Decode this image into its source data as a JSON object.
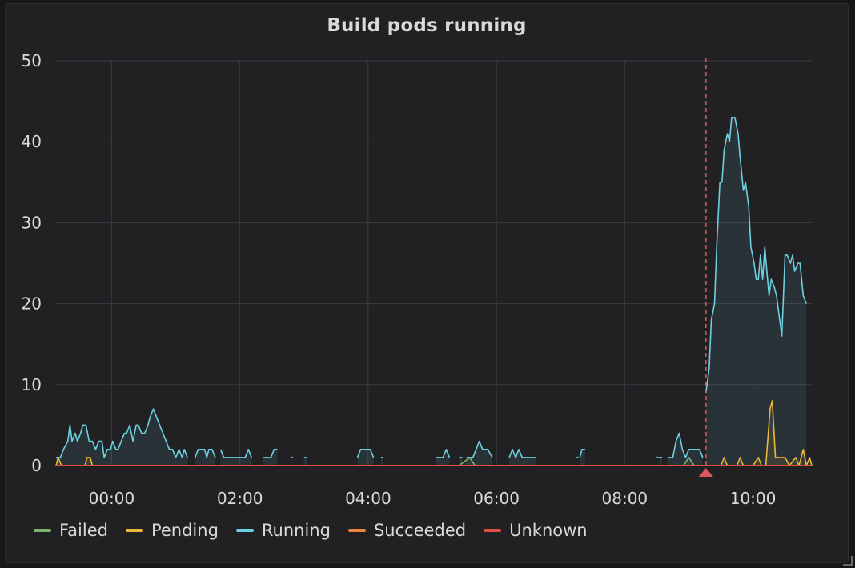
{
  "panel": {
    "title": "Build pods running"
  },
  "chart_data": {
    "type": "line",
    "title": "Build pods running",
    "xlabel": "",
    "ylabel": "",
    "x_tick_labels": [
      "00:00",
      "02:00",
      "04:00",
      "06:00",
      "08:00",
      "10:00"
    ],
    "x_range": [
      "23:08",
      "10:55"
    ],
    "y_ticks": [
      0,
      10,
      20,
      30,
      40,
      50
    ],
    "ylim": [
      0,
      50
    ],
    "grid": true,
    "legend_position": "bottom",
    "annotation": {
      "time": "09:16",
      "color": "#e0575b",
      "style": "dashed"
    },
    "series": [
      {
        "name": "Failed",
        "color": "#7eb26d",
        "points": [
          [
            "23:08",
            0
          ],
          [
            "05:25",
            0
          ],
          [
            "05:35",
            1
          ],
          [
            "05:40",
            0
          ],
          [
            "08:55",
            0
          ],
          [
            "09:00",
            1
          ],
          [
            "09:05",
            0
          ],
          [
            "10:55",
            0
          ]
        ]
      },
      {
        "name": "Pending",
        "color": "#eab839",
        "points": [
          [
            "23:08",
            0
          ],
          [
            "23:10",
            1
          ],
          [
            "23:13",
            0
          ],
          [
            "23:35",
            0
          ],
          [
            "23:37",
            1
          ],
          [
            "23:40",
            1
          ],
          [
            "23:42",
            0
          ],
          [
            "09:30",
            0
          ],
          [
            "09:33",
            1
          ],
          [
            "09:36",
            0
          ],
          [
            "09:45",
            0
          ],
          [
            "09:48",
            1
          ],
          [
            "09:51",
            0
          ],
          [
            "10:00",
            0
          ],
          [
            "10:05",
            1
          ],
          [
            "10:08",
            0
          ],
          [
            "10:12",
            0
          ],
          [
            "10:16",
            7
          ],
          [
            "10:18",
            8
          ],
          [
            "10:21",
            1
          ],
          [
            "10:30",
            1
          ],
          [
            "10:34",
            0
          ],
          [
            "10:40",
            1
          ],
          [
            "10:43",
            0
          ],
          [
            "10:47",
            2
          ],
          [
            "10:50",
            0
          ],
          [
            "10:53",
            1
          ],
          [
            "10:55",
            0
          ]
        ]
      },
      {
        "name": "Running",
        "color": "#6ed0e0",
        "gaps": [
          [
            "23:08",
            1
          ],
          [
            "23:15",
            2
          ],
          [
            "23:20",
            3
          ],
          [
            "23:22",
            5
          ],
          [
            "23:25",
            3
          ],
          [
            "23:28",
            4
          ],
          [
            "23:31",
            3
          ],
          [
            "23:34",
            5
          ],
          [
            "23:37",
            5
          ],
          [
            "23:40",
            3
          ],
          [
            "23:43",
            2
          ],
          [
            "23:46",
            3
          ],
          [
            "23:49",
            3
          ],
          [
            "23:52",
            1
          ],
          [
            "23:55",
            2
          ],
          [
            "23:58",
            2
          ],
          [
            "00:01",
            3
          ],
          [
            "00:04",
            2
          ],
          [
            "00:07",
            2
          ],
          [
            "00:10",
            3
          ],
          [
            "00:13",
            4
          ],
          [
            "00:16",
            4
          ],
          [
            "00:19",
            5
          ],
          [
            "00:22",
            4
          ],
          [
            "00:25",
            5
          ],
          [
            "00:28",
            5
          ],
          [
            "00:31",
            4
          ],
          [
            "00:34",
            4
          ],
          [
            "00:37",
            5
          ],
          [
            "00:40",
            6
          ],
          [
            "00:43",
            7
          ],
          [
            "00:46",
            6
          ],
          [
            "00:49",
            5
          ],
          [
            "00:52",
            4
          ],
          [
            "00:55",
            3
          ],
          [
            "00:58",
            2
          ],
          [
            "01:01",
            2
          ],
          [
            "01:04",
            1
          ],
          [
            "01:07",
            1
          ],
          [
            "01:10",
            2
          ],
          [
            "01:13",
            2
          ],
          [
            "01:16",
            1
          ],
          [
            "01:19",
            1
          ],
          [
            "01:22",
            2
          ],
          [
            "01:25",
            1
          ],
          [
            "01:28",
            1
          ]
        ],
        "segments": [
          [
            [
              "23:08",
              1
            ],
            [
              "23:12",
              1
            ],
            [
              "23:15",
              2
            ],
            [
              "23:19",
              3
            ],
            [
              "23:21",
              5
            ],
            [
              "23:23",
              3
            ],
            [
              "23:26",
              4
            ],
            [
              "23:28",
              3
            ],
            [
              "23:31",
              4
            ],
            [
              "23:33",
              5
            ],
            [
              "23:36",
              5
            ],
            [
              "23:39",
              3
            ],
            [
              "23:42",
              3
            ],
            [
              "23:45",
              2
            ],
            [
              "23:48",
              3
            ],
            [
              "23:51",
              3
            ],
            [
              "23:53",
              1
            ],
            [
              "23:56",
              2
            ],
            [
              "23:59",
              2
            ],
            [
              "00:01",
              3
            ],
            [
              "00:04",
              2
            ],
            [
              "00:06",
              2
            ],
            [
              "00:09",
              3
            ],
            [
              "00:12",
              4
            ],
            [
              "00:14",
              4
            ],
            [
              "00:17",
              5
            ],
            [
              "00:20",
              3
            ],
            [
              "00:23",
              5
            ],
            [
              "00:25",
              5
            ],
            [
              "00:28",
              4
            ],
            [
              "00:31",
              4
            ],
            [
              "00:34",
              5
            ],
            [
              "00:36",
              6
            ],
            [
              "00:39",
              7
            ],
            [
              "00:42",
              6
            ],
            [
              "00:45",
              5
            ],
            [
              "00:48",
              4
            ],
            [
              "00:51",
              3
            ],
            [
              "00:54",
              2
            ],
            [
              "00:57",
              2
            ],
            [
              "01:00",
              1
            ],
            [
              "01:03",
              2
            ],
            [
              "01:06",
              1
            ],
            [
              "01:08",
              2
            ],
            [
              "01:11",
              1
            ]
          ],
          [
            [
              "01:18",
              1
            ],
            [
              "01:21",
              2
            ],
            [
              "01:27",
              2
            ],
            [
              "01:29",
              1
            ],
            [
              "01:31",
              2
            ],
            [
              "01:34",
              2
            ],
            [
              "01:37",
              1
            ]
          ],
          [
            [
              "01:42",
              2
            ],
            [
              "01:45",
              1
            ],
            [
              "02:05",
              1
            ],
            [
              "02:08",
              2
            ],
            [
              "02:11",
              1
            ]
          ],
          [
            [
              "02:22",
              1
            ],
            [
              "02:29",
              1
            ],
            [
              "02:32",
              2
            ],
            [
              "02:35",
              2
            ]
          ],
          [
            [
              "02:48",
              1
            ]
          ],
          [
            [
              "03:00",
              1
            ],
            [
              "03:03",
              1
            ]
          ],
          [
            [
              "03:50",
              1
            ],
            [
              "03:53",
              2
            ],
            [
              "04:02",
              2
            ],
            [
              "04:05",
              1
            ]
          ],
          [
            [
              "04:12",
              1
            ],
            [
              "04:14",
              1
            ]
          ],
          [
            [
              "05:03",
              1
            ],
            [
              "05:10",
              1
            ],
            [
              "05:13",
              2
            ],
            [
              "05:16",
              1
            ]
          ],
          [
            [
              "05:25",
              1
            ],
            [
              "05:28",
              1
            ]
          ],
          [
            [
              "05:32",
              1
            ],
            [
              "05:38",
              1
            ],
            [
              "05:41",
              2
            ],
            [
              "05:44",
              3
            ],
            [
              "05:47",
              2
            ],
            [
              "05:52",
              2
            ],
            [
              "05:56",
              1
            ]
          ],
          [
            [
              "06:12",
              1
            ],
            [
              "06:15",
              2
            ],
            [
              "06:18",
              1
            ],
            [
              "06:21",
              2
            ],
            [
              "06:24",
              1
            ],
            [
              "06:33",
              1
            ],
            [
              "06:37",
              1
            ]
          ],
          [
            [
              "07:15",
              1
            ]
          ],
          [
            [
              "07:18",
              1
            ],
            [
              "07:20",
              2
            ],
            [
              "07:23",
              2
            ]
          ],
          [
            [
              "08:30",
              1
            ]
          ],
          [
            [
              "08:32",
              1
            ],
            [
              "08:35",
              1
            ]
          ],
          [
            [
              "08:40",
              1
            ],
            [
              "08:45",
              1
            ],
            [
              "08:48",
              3
            ],
            [
              "08:51",
              4
            ],
            [
              "08:54",
              2
            ],
            [
              "08:57",
              1
            ],
            [
              "09:00",
              2
            ],
            [
              "09:10",
              2
            ],
            [
              "09:13",
              1
            ]
          ],
          [
            [
              "09:16",
              9
            ],
            [
              "09:19",
              12
            ],
            [
              "09:21",
              18
            ],
            [
              "09:24",
              20
            ],
            [
              "09:26",
              27
            ],
            [
              "09:29",
              35
            ],
            [
              "09:31",
              35
            ],
            [
              "09:33",
              39
            ],
            [
              "09:36",
              41
            ],
            [
              "09:38",
              40
            ],
            [
              "09:40",
              43
            ],
            [
              "09:43",
              43
            ],
            [
              "09:46",
              41
            ],
            [
              "09:48",
              38
            ],
            [
              "09:51",
              34
            ],
            [
              "09:53",
              35
            ],
            [
              "09:56",
              32
            ],
            [
              "09:58",
              27
            ],
            [
              "10:01",
              25
            ],
            [
              "10:03",
              23
            ],
            [
              "10:05",
              23
            ],
            [
              "10:07",
              26
            ],
            [
              "10:09",
              23
            ],
            [
              "10:11",
              27
            ],
            [
              "10:13",
              24
            ],
            [
              "10:15",
              21
            ],
            [
              "10:17",
              23
            ],
            [
              "10:20",
              22
            ],
            [
              "10:22",
              21
            ],
            [
              "10:25",
              18
            ],
            [
              "10:27",
              16
            ],
            [
              "10:30",
              26
            ],
            [
              "10:32",
              26
            ],
            [
              "10:35",
              25
            ],
            [
              "10:37",
              26
            ],
            [
              "10:39",
              24
            ],
            [
              "10:42",
              25
            ],
            [
              "10:44",
              25
            ],
            [
              "10:47",
              21
            ],
            [
              "10:50",
              20
            ]
          ]
        ]
      },
      {
        "name": "Succeeded",
        "color": "#ef843c",
        "points": [
          [
            "23:08",
            0
          ],
          [
            "10:55",
            0
          ]
        ]
      },
      {
        "name": "Unknown",
        "color": "#e24d42",
        "points": [
          [
            "23:08",
            0
          ],
          [
            "10:55",
            0
          ]
        ]
      }
    ]
  }
}
